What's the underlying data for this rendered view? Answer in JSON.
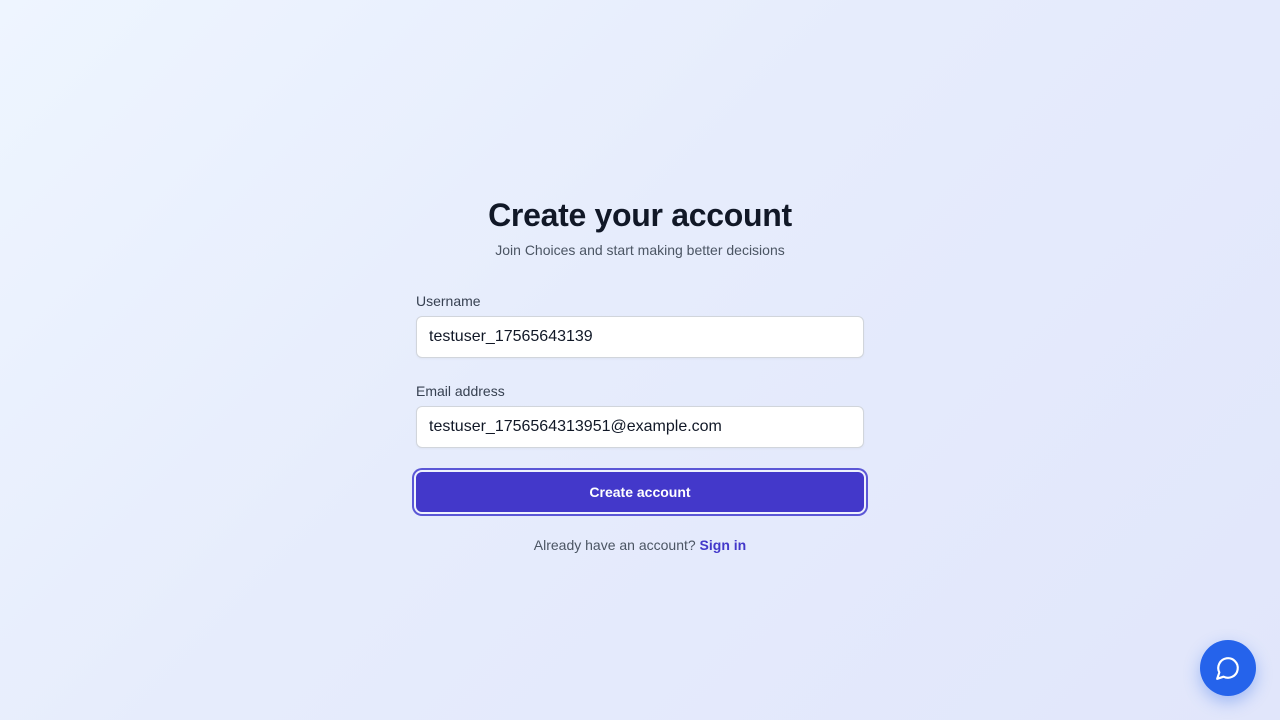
{
  "header": {
    "title": "Create your account",
    "subtitle": "Join Choices and start making better decisions"
  },
  "form": {
    "username": {
      "label": "Username",
      "value": "testuser_17565643139"
    },
    "email": {
      "label": "Email address",
      "value": "testuser_1756564313951@example.com"
    },
    "submit_label": "Create account"
  },
  "footer": {
    "prompt": "Already have an account?",
    "link_label": "Sign in"
  },
  "chat": {
    "icon": "chat-bubble-icon"
  },
  "colors": {
    "primary": "#4338ca",
    "chat_button": "#2563eb",
    "heading": "#111827",
    "muted_text": "#4b5563"
  }
}
